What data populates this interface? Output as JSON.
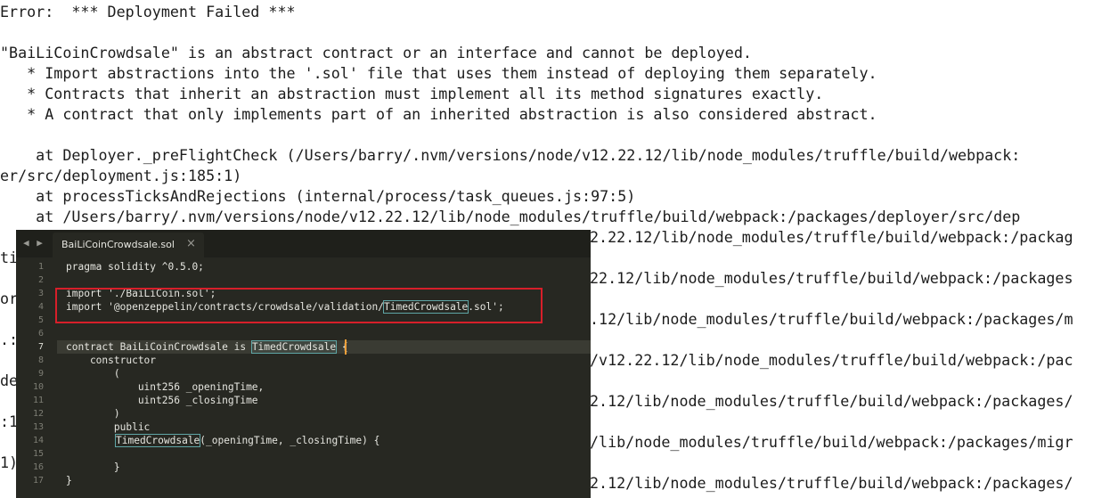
{
  "terminal": {
    "lines": [
      "Error:  *** Deployment Failed ***",
      "",
      "\"BaiLiCoinCrowdsale\" is an abstract contract or an interface and cannot be deployed.",
      "   * Import abstractions into the '.sol' file that uses them instead of deploying them separately.",
      "   * Contracts that inherit an abstraction must implement all its method signatures exactly.",
      "   * A contract that only implements part of an inherited abstraction is also considered abstract.",
      "",
      "    at Deployer._preFlightCheck (/Users/barry/.nvm/versions/node/v12.22.12/lib/node_modules/truffle/build/webpack:",
      "er/src/deployment.js:185:1)",
      "    at processTicksAndRejections (internal/process/task_queues.js:97:5)",
      "    at /Users/barry/.nvm/versions/node/v12.22.12/lib/node_modules/truffle/build/webpack:/packages/deployer/src/dep"
    ],
    "right_fragments": [
      "2.22.12/lib/node_modules/truffle/build/webpack:/packag",
      "22.12/lib/node_modules/truffle/build/webpack:/packages",
      ".12/lib/node_modules/truffle/build/webpack:/packages/m",
      "/v12.22.12/lib/node_modules/truffle/build/webpack:/pac",
      "2.12/lib/node_modules/truffle/build/webpack:/packages/",
      "/lib/node_modules/truffle/build/webpack:/packages/migr",
      "2.12/lib/node_modules/truffle/build/webpack:/packages/"
    ],
    "left_fragments": [
      "ti",
      "or",
      ".:",
      "de",
      ":1",
      "1)"
    ]
  },
  "editor": {
    "tab_title": "BaiLiCoinCrowdsale.sol",
    "tab_close": "×",
    "nav_arrows": "◀ ▶",
    "line_numbers": [
      "1",
      "2",
      "3",
      "4",
      "5",
      "6",
      "7",
      "8",
      "9",
      "10",
      "11",
      "12",
      "13",
      "14",
      "15",
      "16",
      "17"
    ],
    "current_line": "7",
    "code": {
      "l1": "pragma solidity ^0.5.0;",
      "l3": "import './BaiLiCoin.sol';",
      "l4a": "import '@openzeppelin/contracts/crowdsale/validation/",
      "l4b": "TimedCrowdsale",
      "l4c": ".sol';",
      "l7a": "contract BaiLiCoinCrowdsale is ",
      "l7b": "TimedCrowdsale",
      "l7c": " {",
      "l8": "    constructor",
      "l9": "        (",
      "l10": "            uint256 _openingTime,",
      "l11": "            uint256 _closingTime",
      "l12": "        )",
      "l13": "        public",
      "l14a": "TimedCrowdsale",
      "l14b": "(_openingTime, _closingTime) {",
      "l16": "        }",
      "l17": "}"
    },
    "colors": {
      "background": "#272822",
      "highlight_box": "#d71f2a",
      "match_outline": "#5fa6a6",
      "cursor": "#f0a03a"
    }
  }
}
